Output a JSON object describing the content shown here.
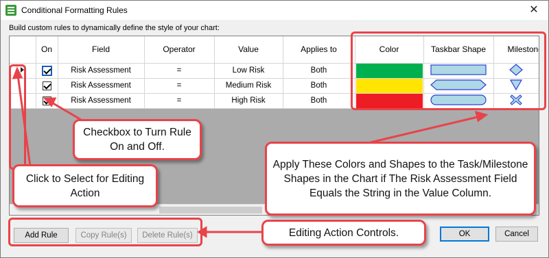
{
  "window": {
    "title": "Conditional Formatting Rules",
    "close_glyph": "✕"
  },
  "subtitle": "Build custom rules to dynamically define the style of your chart:",
  "grid": {
    "columns": {
      "on": "On",
      "field": "Field",
      "operator": "Operator",
      "value": "Value",
      "applies_to": "Applies to",
      "color": "Color",
      "taskbar_shape": "Taskbar Shape",
      "milestone_shape": "Milestone Shape"
    },
    "rows": [
      {
        "selected": true,
        "on": true,
        "field": "Risk Assessment",
        "operator": "=",
        "value": "Low Risk",
        "applies_to": "Both",
        "color": "#00b04f",
        "taskbar_icon": "rectangle-shape-icon",
        "milestone_icon": "diamond-shape-icon"
      },
      {
        "selected": false,
        "on": true,
        "field": "Risk Assessment",
        "operator": "=",
        "value": "Medium Risk",
        "applies_to": "Both",
        "color": "#ffe500",
        "taskbar_icon": "hexagon-shape-icon",
        "milestone_icon": "triangle-down-shape-icon"
      },
      {
        "selected": false,
        "on": true,
        "field": "Risk Assessment",
        "operator": "=",
        "value": "High Risk",
        "applies_to": "Both",
        "color": "#ee1c24",
        "taskbar_icon": "rounded-bar-shape-icon",
        "milestone_icon": "x-shape-icon"
      }
    ]
  },
  "buttons": {
    "add_rule": "Add Rule",
    "copy_rules": "Copy Rule(s)",
    "delete_rules": "Delete Rule(s)",
    "ok": "OK",
    "cancel": "Cancel"
  },
  "annotations": {
    "checkbox": "Checkbox to Turn Rule On and Off.",
    "select": "Click to Select for Editing Action",
    "apply": "Apply These Colors and Shapes to the Task/Milestone Shapes in the Chart if The Risk Assessment Field Equals the String in the Value Column.",
    "editing": "Editing Action Controls.",
    "accent_color": "#e8434a"
  },
  "colors": {
    "shape_fill": "#aed8e6",
    "shape_stroke": "#2b3fd6"
  }
}
